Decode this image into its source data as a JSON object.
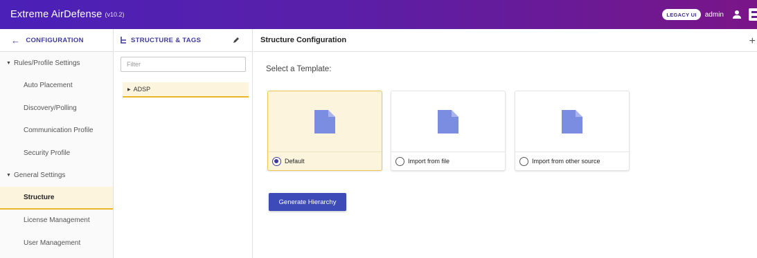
{
  "app": {
    "title": "Extreme AirDefense",
    "version": "(v10.2)"
  },
  "topbar": {
    "legacy_label": "LEGACY UI",
    "user": "admin"
  },
  "nav": {
    "header": "CONFIGURATION",
    "items": [
      {
        "label": "Rules/Profile Settings",
        "type": "group"
      },
      {
        "label": "Auto Placement",
        "type": "item"
      },
      {
        "label": "Discovery/Polling",
        "type": "item"
      },
      {
        "label": "Communication Profile",
        "type": "item"
      },
      {
        "label": "Security Profile",
        "type": "item"
      },
      {
        "label": "General Settings",
        "type": "group"
      },
      {
        "label": "Structure",
        "type": "item",
        "active": true
      },
      {
        "label": "License Management",
        "type": "item"
      },
      {
        "label": "User Management",
        "type": "item"
      }
    ]
  },
  "tags_panel": {
    "header": "STRUCTURE & TAGS",
    "filter_placeholder": "Filter",
    "tree": [
      {
        "label": "ADSP"
      }
    ]
  },
  "main": {
    "header": "Structure Configuration",
    "select_label": "Select a Template:",
    "templates": [
      {
        "label": "Default",
        "selected": true
      },
      {
        "label": "Import from file",
        "selected": false
      },
      {
        "label": "Import from other source",
        "selected": false
      }
    ],
    "generate_button": "Generate Hierarchy"
  },
  "colors": {
    "accent": "#3d3a9c",
    "selection_bg": "#fdf4de",
    "selection_border": "#e8b628",
    "doc_icon": "#7b8de0",
    "button": "#3d4bb8"
  }
}
